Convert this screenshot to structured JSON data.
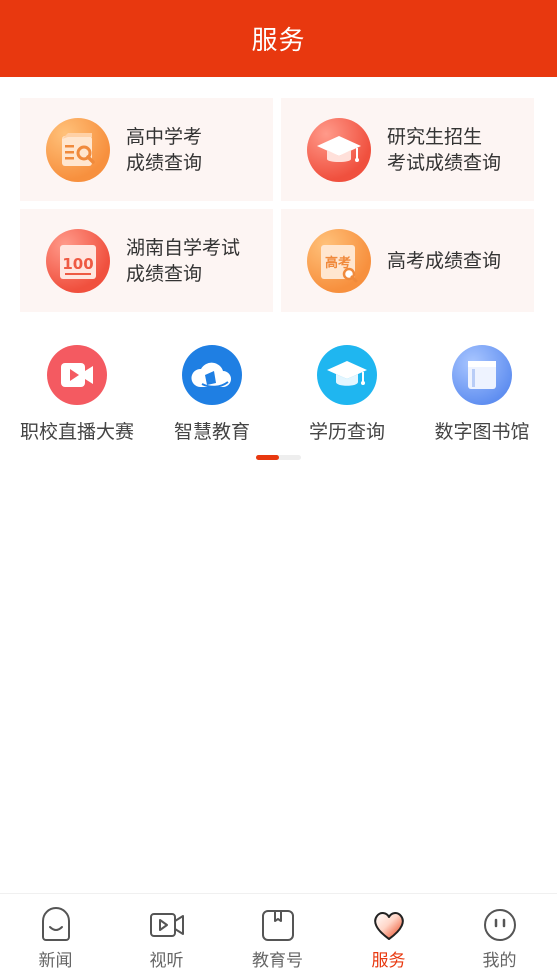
{
  "header": {
    "title": "服务"
  },
  "cards": [
    {
      "label": "高中学考\n成绩查询",
      "icon": "search-document-icon"
    },
    {
      "label": "研究生招生\n考试成绩查询",
      "icon": "graduation-cap-icon"
    },
    {
      "label": "湖南自学考试\n成绩查询",
      "icon": "score-paper-icon"
    },
    {
      "label": "高考成绩查询",
      "icon": "gaokao-search-icon",
      "icon_text": "高考"
    }
  ],
  "quick_links": [
    {
      "label": "职校直播大赛",
      "icon": "video-play-icon"
    },
    {
      "label": "智慧教育",
      "icon": "cloud-book-icon"
    },
    {
      "label": "学历查询",
      "icon": "graduation-cap-icon"
    },
    {
      "label": "数字图书馆",
      "icon": "book-icon"
    }
  ],
  "score_icon_text": "100",
  "pager": {
    "pages": 2,
    "active": 1
  },
  "tabbar": [
    {
      "label": "新闻",
      "icon": "news-face-icon"
    },
    {
      "label": "视听",
      "icon": "video-camera-icon"
    },
    {
      "label": "教育号",
      "icon": "open-book-icon"
    },
    {
      "label": "服务",
      "icon": "heart-icon",
      "active": true
    },
    {
      "label": "我的",
      "icon": "profile-face-icon"
    }
  ],
  "colors": {
    "brand": "#e8380f",
    "card_bg": "#fdf5f3"
  }
}
